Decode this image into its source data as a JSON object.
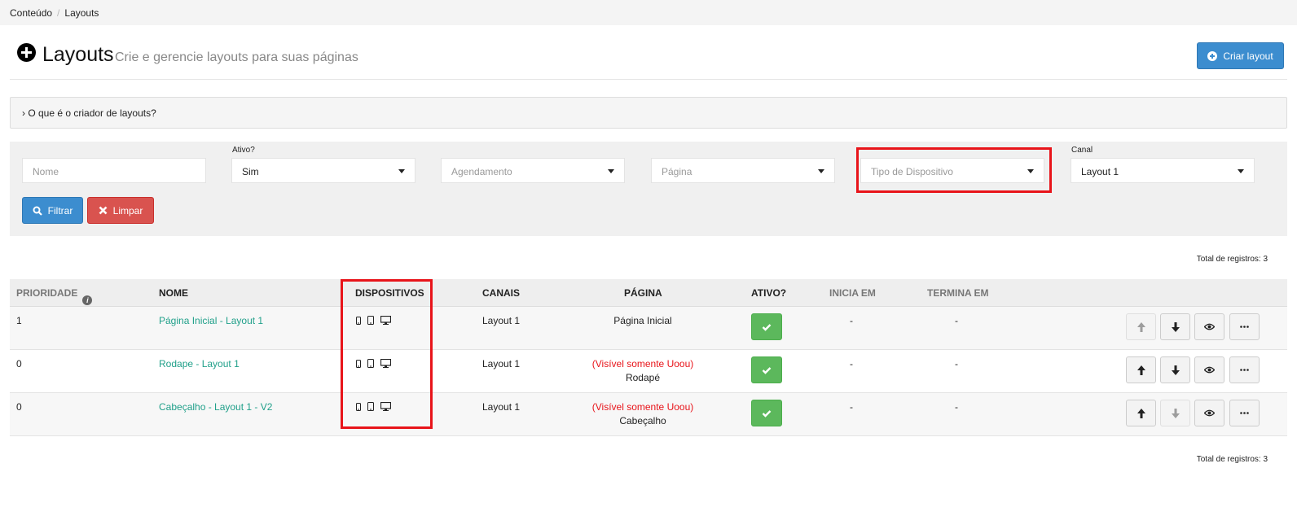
{
  "breadcrumb": {
    "items": [
      "Conteúdo",
      "Layouts"
    ],
    "separator": "/"
  },
  "header": {
    "title": "Layouts",
    "subtitle": "Crie e gerencie layouts para suas páginas",
    "create_label": "Criar layout"
  },
  "info_panel": {
    "label": "› O que é o criador de layouts?"
  },
  "filters": {
    "nome_placeholder": "Nome",
    "ativo_label": "Ativo?",
    "ativo_value": "Sim",
    "agendamento_placeholder": "Agendamento",
    "pagina_placeholder": "Página",
    "tipo_dispositivo_placeholder": "Tipo de Dispositivo",
    "canal_label": "Canal",
    "canal_value": "Layout 1",
    "filtrar_label": "Filtrar",
    "limpar_label": "Limpar"
  },
  "total_label": "Total de registros: 3",
  "table": {
    "columns": {
      "prioridade": "PRIORIDADE",
      "nome": "NOME",
      "dispositivos": "DISPOSITIVOS",
      "canais": "CANAIS",
      "pagina": "PÁGINA",
      "ativo": "ATIVO?",
      "inicia": "INICIA EM",
      "termina": "TERMINA EM"
    },
    "rows": [
      {
        "prioridade": "1",
        "nome": "Página Inicial - Layout 1",
        "canal": "Layout 1",
        "visibility": "",
        "pagina": "Página Inicial",
        "inicia": "-",
        "termina": "-",
        "up_enabled": false,
        "down_enabled": true
      },
      {
        "prioridade": "0",
        "nome": "Rodape - Layout 1",
        "canal": "Layout 1",
        "visibility": "(Visível somente Uoou)",
        "pagina": "Rodapé",
        "inicia": "-",
        "termina": "-",
        "up_enabled": true,
        "down_enabled": true
      },
      {
        "prioridade": "0",
        "nome": "Cabeçalho - Layout 1 - V2",
        "canal": "Layout 1",
        "visibility": "(Visível somente Uoou)",
        "pagina": "Cabeçalho",
        "inicia": "-",
        "termina": "-",
        "up_enabled": true,
        "down_enabled": false
      }
    ]
  },
  "icons": [
    "plus-circle-icon",
    "search-icon",
    "times-icon",
    "info-icon",
    "mobile-icon",
    "tablet-icon",
    "desktop-icon",
    "check-icon",
    "arrow-up-icon",
    "arrow-down-icon",
    "eye-icon",
    "ellipsis-icon"
  ],
  "colors": {
    "primary": "#3c8dcf",
    "danger": "#d9534f",
    "success": "#5cb85c",
    "link": "#21a08a",
    "highlight": "#e8141a"
  }
}
